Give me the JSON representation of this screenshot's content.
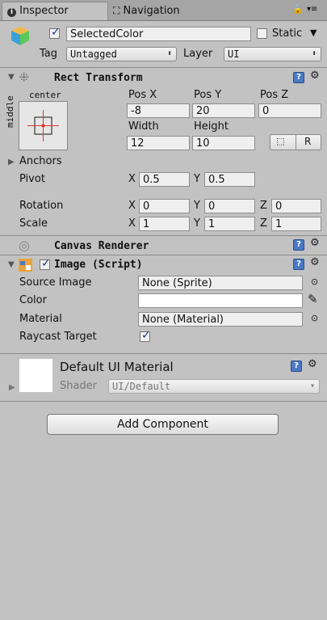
{
  "tabs": {
    "inspector": "Inspector",
    "navigation": "Navigation"
  },
  "object": {
    "name": "SelectedColor",
    "static_label": "Static",
    "tag_label": "Tag",
    "tag_value": "Untagged",
    "layer_label": "Layer",
    "layer_value": "UI"
  },
  "rect_transform": {
    "title": "Rect Transform",
    "anchor_top_label": "center",
    "anchor_side_label": "middle",
    "col_labels": [
      "Pos X",
      "Pos Y",
      "Pos Z"
    ],
    "pos": [
      "-8",
      "20",
      "0"
    ],
    "width_label": "Width",
    "height_label": "Height",
    "width": "12",
    "height": "10",
    "r_button": "R",
    "anchors_label": "Anchors",
    "pivot_label": "Pivot",
    "pivot": [
      "0.5",
      "0.5"
    ],
    "rotation_label": "Rotation",
    "rotation": [
      "0",
      "0",
      "0"
    ],
    "scale_label": "Scale",
    "scale": [
      "1",
      "1",
      "1"
    ],
    "axis": [
      "X",
      "Y",
      "Z"
    ]
  },
  "canvas_renderer": {
    "title": "Canvas Renderer"
  },
  "image": {
    "title": "Image (Script)",
    "source_label": "Source Image",
    "source_value": "None (Sprite)",
    "color_label": "Color",
    "material_label": "Material",
    "material_value": "None (Material)",
    "raycast_label": "Raycast Target"
  },
  "material": {
    "title": "Default UI Material",
    "shader_label": "Shader",
    "shader_value": "UI/Default"
  },
  "add_component": "Add Component",
  "colors": {
    "panel": "#c2c2c2",
    "help_icon": "#4a78c4"
  }
}
